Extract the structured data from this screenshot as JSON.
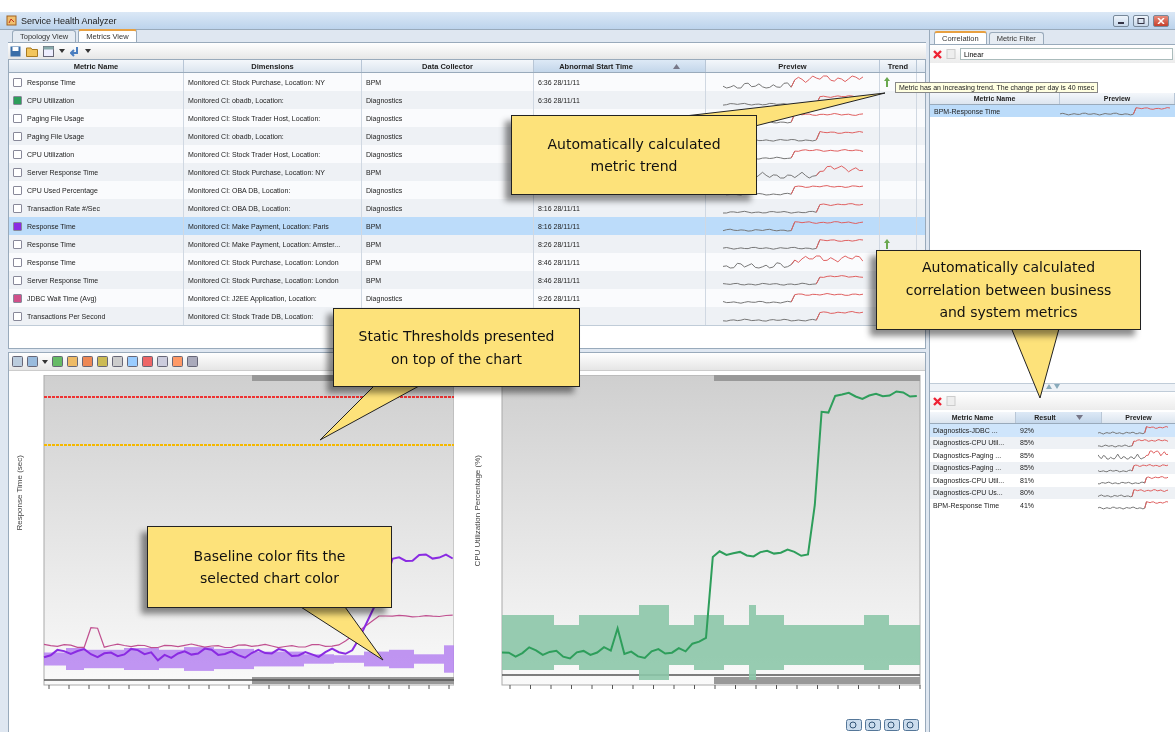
{
  "window": {
    "title": "Service Health Analyzer"
  },
  "tabs": [
    {
      "label": "Topology View",
      "selected": false
    },
    {
      "label": "Metrics View",
      "selected": true
    }
  ],
  "metrics_table": {
    "columns": [
      {
        "label": "Metric Name",
        "sorted": false
      },
      {
        "label": "Dimensions",
        "sorted": false
      },
      {
        "label": "Data Collector",
        "sorted": false
      },
      {
        "label": "Abnormal Start Time",
        "sorted": true,
        "descending": false
      },
      {
        "label": "Preview",
        "sorted": false
      },
      {
        "label": "Trend",
        "sorted": false
      }
    ],
    "rows": [
      {
        "metric": "Response Time",
        "checked": false,
        "dimensions": "Monitored CI: Stock Purchase, Location: NY",
        "collector": "BPM",
        "start_time": "6:36 28/11/11",
        "trend_up": true,
        "selected": false
      },
      {
        "metric": "CPU Utilization",
        "checked": true,
        "color": "#2e9e5b",
        "dimensions": "Monitored CI: obadb, Location:",
        "collector": "Diagnostics",
        "start_time": "6:36 28/11/11",
        "trend_up": false,
        "selected": false
      },
      {
        "metric": "Paging File Usage",
        "checked": false,
        "dimensions": "Monitored CI: Stock Trader Host, Location:",
        "collector": "Diagnostics",
        "trend_up": false,
        "selected": false
      },
      {
        "metric": "Paging File Usage",
        "checked": false,
        "dimensions": "Monitored CI: obadb, Location:",
        "collector": "Diagnostics",
        "trend_up": false,
        "selected": false
      },
      {
        "metric": "CPU Utilization",
        "checked": false,
        "dimensions": "Monitored CI: Stock Trader Host, Location:",
        "collector": "Diagnostics",
        "trend_up": false,
        "selected": false
      },
      {
        "metric": "Server Response Time",
        "checked": false,
        "dimensions": "Monitored CI: Stock Purchase, Location: NY",
        "collector": "BPM",
        "trend_up": false,
        "selected": false
      },
      {
        "metric": "CPU Used Percentage",
        "checked": false,
        "dimensions": "Monitored CI: OBA DB, Location:",
        "collector": "Diagnostics",
        "trend_up": false,
        "selected": false
      },
      {
        "metric": "Transaction Rate #/Sec",
        "checked": false,
        "dimensions": "Monitored CI: OBA DB, Location:",
        "collector": "Diagnostics",
        "start_time": "8:16 28/11/11",
        "trend_up": false,
        "selected": false
      },
      {
        "metric": "Response Time",
        "checked": true,
        "color": "#8a2be2",
        "dimensions": "Monitored CI: Make Payment, Location: Paris",
        "collector": "BPM",
        "start_time": "8:16 28/11/11",
        "trend_up": false,
        "selected": true
      },
      {
        "metric": "Response Time",
        "checked": false,
        "dimensions": "Monitored CI: Make Payment, Location: Amster...",
        "collector": "BPM",
        "start_time": "8:26 28/11/11",
        "trend_up": true,
        "selected": false
      },
      {
        "metric": "Response Time",
        "checked": false,
        "dimensions": "Monitored CI: Stock Purchase, Location: London",
        "collector": "BPM",
        "start_time": "8:46 28/11/11",
        "trend_up": false,
        "selected": false
      },
      {
        "metric": "Server Response Time",
        "checked": false,
        "dimensions": "Monitored CI: Stock Purchase, Location: London",
        "collector": "BPM",
        "start_time": "8:46 28/11/11",
        "trend_up": false,
        "selected": false
      },
      {
        "metric": "JDBC Wait Time (Avg)",
        "checked": true,
        "color": "#d0508a",
        "dimensions": "Monitored CI: J2EE Application, Location:",
        "collector": "Diagnostics",
        "start_time": "9:26 28/11/11",
        "trend_up": false,
        "selected": false
      },
      {
        "metric": "Transactions Per Second",
        "checked": false,
        "dimensions": "Monitored CI: Stock Trade DB, Location:",
        "trend_up": false,
        "selected": false
      }
    ]
  },
  "trend_tooltip": {
    "text": "Metric has an increasing trend. The change per day is 40  msec"
  },
  "charts": [
    {
      "kind": "response",
      "y_label": "Response Time (sec)"
    },
    {
      "kind": "cpu",
      "y_label": "CPU Utilization Percentage (%)"
    }
  ],
  "correlation_panel": {
    "tabs": [
      {
        "label": "Correlation",
        "selected": true
      },
      {
        "label": "Metric Filter",
        "selected": false
      }
    ],
    "filter": {
      "value": "Linear"
    },
    "columns": [
      {
        "label": "Metric Name"
      },
      {
        "label": "Preview"
      }
    ],
    "rows": [
      {
        "name": "BPM-Response Time",
        "selected": true
      }
    ]
  },
  "results_table": {
    "columns": [
      {
        "label": "Metric Name",
        "sorted": false
      },
      {
        "label": "Result",
        "sorted": true,
        "descending": true
      },
      {
        "label": "Preview",
        "sorted": false
      }
    ],
    "rows": [
      {
        "name": "Diagnostics-JDBC ...",
        "result": "92%",
        "selected": true
      },
      {
        "name": "Diagnostics-CPU Util...",
        "result": "85%",
        "selected": false
      },
      {
        "name": "Diagnostics-Paging ...",
        "result": "85%",
        "selected": false
      },
      {
        "name": "Diagnostics-Paging ...",
        "result": "85%",
        "selected": false
      },
      {
        "name": "Diagnostics-CPU Util...",
        "result": "81%",
        "selected": false
      },
      {
        "name": "Diagnostics-CPU Us...",
        "result": "80%",
        "selected": false
      },
      {
        "name": "BPM-Response Time",
        "result": "41%",
        "selected": false
      }
    ]
  },
  "callouts": [
    {
      "text": "Automatically calculated metric trend"
    },
    {
      "text": "Static Thresholds presented on top of the chart"
    },
    {
      "text": "Automatically calculated correlation between business and system metrics"
    },
    {
      "text": "Baseline color fits the selected chart color"
    }
  ]
}
